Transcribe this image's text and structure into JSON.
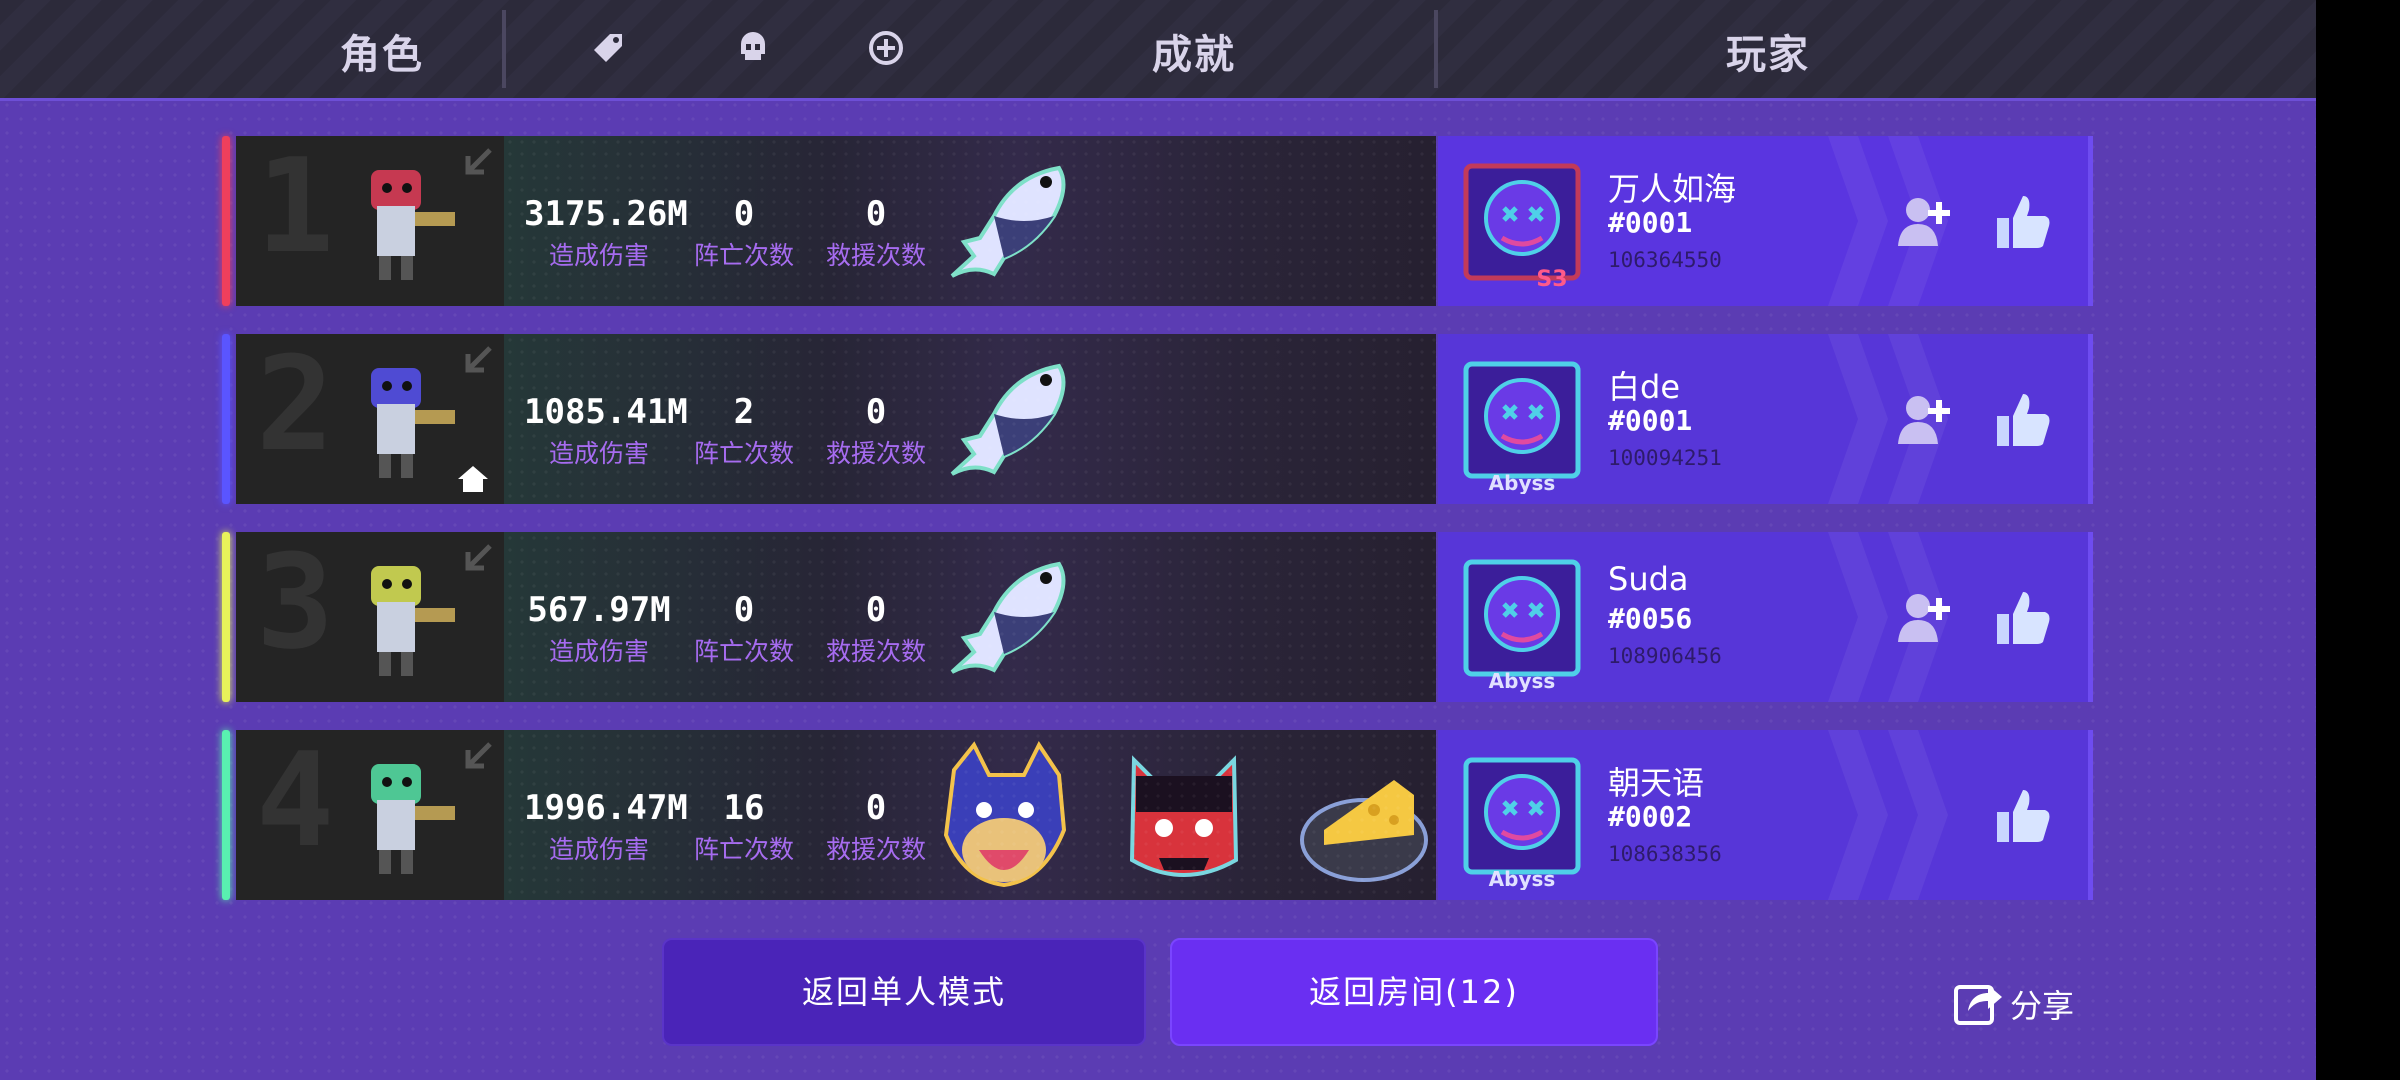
{
  "header": {
    "tab_character": "角色",
    "tab_achievements": "成就",
    "tab_player": "玩家",
    "filter_icons": [
      "tag-icon",
      "skull-icon",
      "crosshair-plus-icon"
    ]
  },
  "players": [
    {
      "rank": "1",
      "accent": "#ef3f5c",
      "is_host": false,
      "damage": "3175.26M",
      "deaths": "0",
      "rescues": "0",
      "damage_label": "造成伤害",
      "deaths_label": "阵亡次数",
      "rescues_label": "救援次数",
      "achievements": [
        "fish-icon"
      ],
      "name": "万人如海",
      "tag": "#0001",
      "id": "106364550",
      "avatar_badge": "S3",
      "can_add_friend": true
    },
    {
      "rank": "2",
      "accent": "#5a55ff",
      "is_host": true,
      "damage": "1085.41M",
      "deaths": "2",
      "rescues": "0",
      "damage_label": "造成伤害",
      "deaths_label": "阵亡次数",
      "rescues_label": "救援次数",
      "achievements": [
        "fish-icon"
      ],
      "name": "白de",
      "tag": "#0001",
      "id": "100094251",
      "avatar_badge": "Abyss",
      "can_add_friend": true
    },
    {
      "rank": "3",
      "accent": "#e8f25a",
      "is_host": false,
      "damage": "567.97M",
      "deaths": "0",
      "rescues": "0",
      "damage_label": "造成伤害",
      "deaths_label": "阵亡次数",
      "rescues_label": "救援次数",
      "achievements": [
        "fish-icon"
      ],
      "name": "Suda",
      "tag": "#0056",
      "id": "108906456",
      "avatar_badge": "Abyss",
      "can_add_friend": true
    },
    {
      "rank": "4",
      "accent": "#59f0b0",
      "is_host": false,
      "damage": "1996.47M",
      "deaths": "16",
      "rescues": "0",
      "damage_label": "造成伤害",
      "deaths_label": "阵亡次数",
      "rescues_label": "救援次数",
      "achievements": [
        "wolf-icon",
        "red-demon-icon",
        "cheese-icon"
      ],
      "name": "朝天语",
      "tag": "#0002",
      "id": "108638356",
      "avatar_badge": "Abyss",
      "can_add_friend": false
    }
  ],
  "buttons": {
    "return_single": "返回单人模式",
    "return_room": "返回房间(12)",
    "share": "分享"
  }
}
